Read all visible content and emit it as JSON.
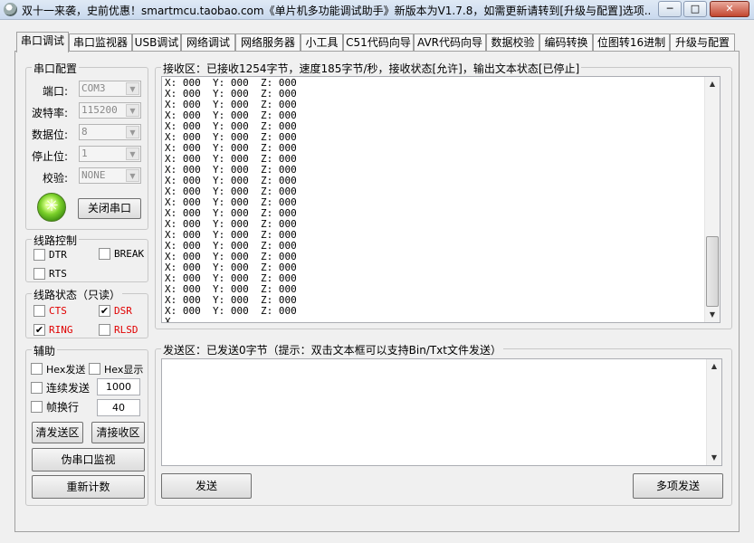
{
  "window": {
    "title": "双十一来袭，史前优惠！smartmcu.taobao.com《单片机多功能调试助手》新版本为V1.7.8，如需更新请转到[升级与配置]选项...",
    "minimize": "─",
    "maximize": "□",
    "close": "✕"
  },
  "tabs": [
    "串口调试",
    "串口监视器",
    "USB调试",
    "网络调试",
    "网络服务器",
    "小工具",
    "C51代码向导",
    "AVR代码向导",
    "数据校验",
    "编码转换",
    "位图转16进制",
    "升级与配置"
  ],
  "serial_config": {
    "legend": "串口配置",
    "port_label": "端口:",
    "port_value": "COM3",
    "baud_label": "波特率:",
    "baud_value": "115200",
    "databits_label": "数据位:",
    "databits_value": "8",
    "stopbits_label": "停止位:",
    "stopbits_value": "1",
    "parity_label": "校验:",
    "parity_value": "NONE",
    "close_port_button": "关闭串口"
  },
  "line_control": {
    "legend": "线路控制",
    "dtr": "DTR",
    "break": "BREAK",
    "rts": "RTS"
  },
  "line_status": {
    "legend": "线路状态（只读）",
    "cts": "CTS",
    "dsr": "DSR",
    "ring": "RING",
    "rlsd": "RLSD",
    "dsr_checked": true,
    "ring_checked": true
  },
  "assist": {
    "legend": "辅助",
    "hex_send": "Hex发送",
    "hex_display": "Hex显示",
    "continuous_send": "连续发送",
    "continuous_interval": "1000",
    "frame_newline": "帧换行",
    "frame_value": "40",
    "clear_send_button": "清发送区",
    "clear_receive_button": "清接收区",
    "pseudo_monitor_button": "伪串口监视",
    "recount_button": "重新计数"
  },
  "receive": {
    "legend": "接收区：已接收1254字节，速度185字节/秒，接收状态[允许]，输出文本状态[已停止]",
    "lines": [
      "X: 000  Y: 000  Z: 000",
      "X: 000  Y: 000  Z: 000",
      "X: 000  Y: 000  Z: 000",
      "X: 000  Y: 000  Z: 000",
      "X: 000  Y: 000  Z: 000",
      "X: 000  Y: 000  Z: 000",
      "X: 000  Y: 000  Z: 000",
      "X: 000  Y: 000  Z: 000",
      "X: 000  Y: 000  Z: 000",
      "X: 000  Y: 000  Z: 000",
      "X: 000  Y: 000  Z: 000",
      "X: 000  Y: 000  Z: 000",
      "X: 000  Y: 000  Z: 000",
      "X: 000  Y: 000  Z: 000",
      "X: 000  Y: 000  Z: 000",
      "X: 000  Y: 000  Z: 000",
      "X: 000  Y: 000  Z: 000",
      "X: 000  Y: 000  Z: 000",
      "X: 000  Y: 000  Z: 000",
      "X: 000  Y: 000  Z: 000",
      "X: 000  Y: 000  Z: 000",
      "X: 000  Y: 000  Z: 000",
      "X"
    ]
  },
  "send": {
    "legend": "发送区：已发送0字节（提示：双击文本框可以支持Bin/Txt文件发送）",
    "content": "",
    "send_button": "发送",
    "multi_send_button": "多项发送"
  },
  "colors": {
    "status_red": "#e00000",
    "led_green": "#7bd02a"
  }
}
